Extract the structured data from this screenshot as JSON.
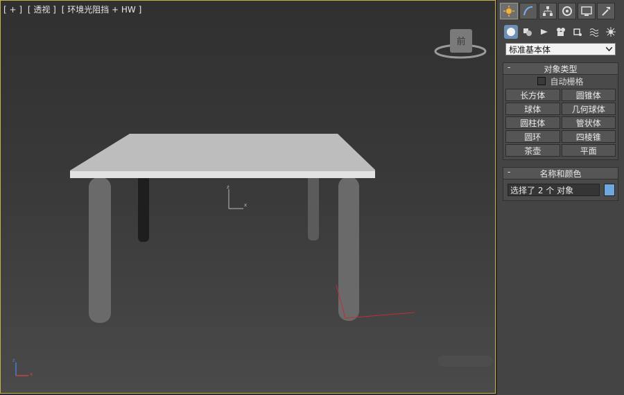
{
  "viewport": {
    "label_parts": [
      "[ + ]",
      "[ 透视 ]",
      "[ 环境光阻挡 + HW ]"
    ],
    "viewcube_face": "前"
  },
  "panel": {
    "tabs": [
      {
        "name": "create-icon"
      },
      {
        "name": "modify-icon"
      },
      {
        "name": "hierarchy-icon"
      },
      {
        "name": "motion-icon"
      },
      {
        "name": "display-icon"
      },
      {
        "name": "utilities-icon"
      }
    ],
    "subtabs": [
      {
        "name": "geometry-icon"
      },
      {
        "name": "shapes-icon"
      },
      {
        "name": "lights-icon"
      },
      {
        "name": "cameras-icon"
      },
      {
        "name": "helpers-icon"
      },
      {
        "name": "spacewarps-icon"
      },
      {
        "name": "systems-icon"
      }
    ],
    "dropdown_value": "标准基本体",
    "object_type": {
      "title": "对象类型",
      "autogrid_label": "自动栅格",
      "buttons": [
        "长方体",
        "圆锥体",
        "球体",
        "几何球体",
        "圆柱体",
        "管状体",
        "圆环",
        "四棱锥",
        "茶壶",
        "平面"
      ]
    },
    "name_color": {
      "title": "名称和颜色",
      "name_value": "选择了 2 个 对象",
      "color": "#6fa8dc"
    }
  }
}
